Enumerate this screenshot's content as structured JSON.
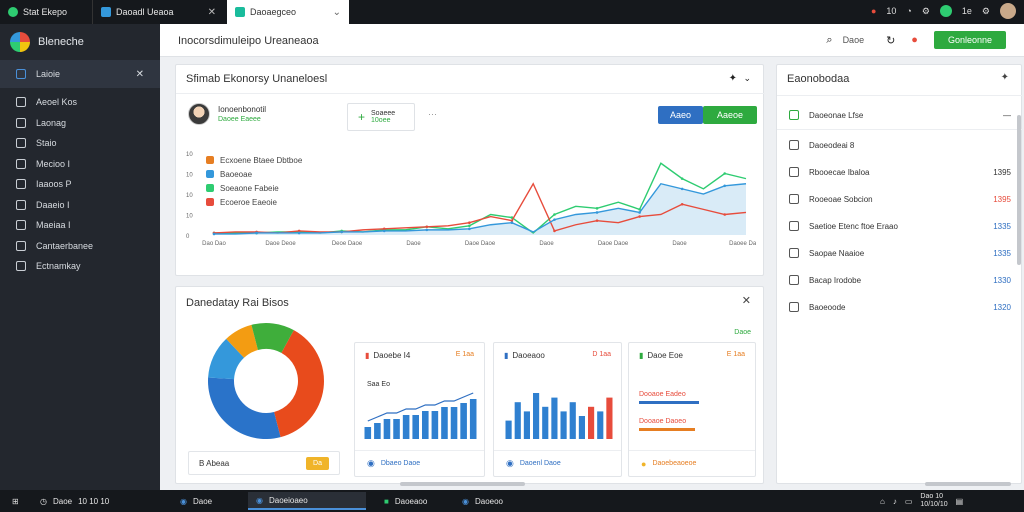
{
  "browser": {
    "tabs": [
      {
        "label": "Stat Ekepo",
        "color": "#2ecc71"
      },
      {
        "label": "Daoadl Ueaoa",
        "color": "#3498db"
      },
      {
        "label": "Daoaegceo",
        "color": "#1abc9c"
      }
    ],
    "top_right": {
      "notif_count": "10",
      "user": "1e"
    }
  },
  "sidebar": {
    "brand": "Bleneche",
    "items": [
      {
        "label": "Laioie",
        "icon": "dashboard-icon",
        "active": true
      },
      {
        "label": "Aeoel Kos",
        "icon": "wrench-icon"
      },
      {
        "label": "Laonag",
        "icon": "tools-icon"
      },
      {
        "label": "Staio",
        "icon": "gear-icon"
      },
      {
        "label": "Mecioo I",
        "icon": "chart-icon"
      },
      {
        "label": "Iaaoos P",
        "icon": "refresh-icon"
      },
      {
        "label": "Daaeio I",
        "icon": "clipboard-icon"
      },
      {
        "label": "Maeiaa I",
        "icon": "lock-icon"
      },
      {
        "label": "Cantaerbanee",
        "icon": "chat-icon"
      },
      {
        "label": "Ectnamkay",
        "icon": "user-icon"
      }
    ]
  },
  "header": {
    "title": "Inocorsdimuleipo Ureaneaoa",
    "search_label": "Daoe",
    "action_label": "Gonleonne"
  },
  "trend_card": {
    "title": "Sfimab Ekonorsy Unaneloesl",
    "user_name": "Ionoenbonotil",
    "user_sub": "Daoee Eaeee",
    "metric_label": "Soaeee",
    "metric_value": "10oee",
    "btn_blue": "Aaeo",
    "btn_green": "Aaeoe",
    "legend": [
      {
        "label": "Ecxoene Btaee Dbtboe",
        "color": "#e67e22"
      },
      {
        "label": "Baoeoae",
        "color": "#3498db"
      },
      {
        "label": "Soeaone Fabeie",
        "color": "#2ecc71"
      },
      {
        "label": "Ecoeroe Eaeoie",
        "color": "#e74c3c"
      }
    ],
    "y_ticks": [
      "10",
      "10",
      "10",
      "10",
      "0"
    ],
    "x_ticks": [
      "Dao Dao",
      "Daoe Deoe",
      "Deoe Daoe",
      "Daoe",
      "Daoe Daoe",
      "Daoe",
      "Daoe Daoe",
      "Daoe",
      "Daoee Daoe"
    ]
  },
  "chart_data": {
    "type": "line",
    "x": [
      0,
      1,
      2,
      3,
      4,
      5,
      6,
      7,
      8,
      9,
      10,
      11,
      12,
      13,
      14,
      15,
      16,
      17,
      18,
      19,
      20,
      21,
      22,
      23,
      24,
      25
    ],
    "series": [
      {
        "color": "#2ecc71",
        "values": [
          2,
          2,
          2,
          3,
          3,
          2,
          4,
          3,
          5,
          5,
          8,
          6,
          9,
          20,
          17,
          2,
          20,
          28,
          26,
          32,
          25,
          70,
          55,
          45,
          60,
          55
        ]
      },
      {
        "color": "#e74c3c",
        "values": [
          2,
          3,
          3,
          2,
          4,
          3,
          3,
          5,
          6,
          7,
          8,
          9,
          12,
          18,
          14,
          50,
          4,
          10,
          14,
          12,
          18,
          20,
          30,
          25,
          20,
          22
        ]
      },
      {
        "color": "#3498db",
        "values": [
          1,
          1,
          2,
          2,
          2,
          2,
          3,
          3,
          4,
          4,
          5,
          5,
          6,
          10,
          12,
          3,
          15,
          20,
          22,
          26,
          22,
          50,
          45,
          40,
          48,
          50
        ]
      }
    ],
    "ylim": [
      0,
      80
    ]
  },
  "distribution_card": {
    "title": "Danedatay Rai Bisos",
    "footer_label": "B Abeaa",
    "footer_button": "Da",
    "link": "Daoe",
    "donut": [
      {
        "value": 38,
        "color": "#e84b1c"
      },
      {
        "value": 30,
        "color": "#2a73c9"
      },
      {
        "value": 12,
        "color": "#3498db"
      },
      {
        "value": 8,
        "color": "#f39c12"
      },
      {
        "value": 12,
        "color": "#3fae3b"
      }
    ],
    "mini_cards": [
      {
        "title": "Daoebe I4",
        "value": "E 1aa",
        "label": "Saa Eo",
        "footer": "Dbaeo Daoe",
        "bars": [
          3,
          4,
          5,
          5,
          6,
          6,
          7,
          7,
          8,
          8,
          9,
          10
        ]
      },
      {
        "title": "Daoeaoo",
        "value": "D 1aa",
        "label": "",
        "footer": "Daoenl Daoe",
        "bars": [
          4,
          8,
          6,
          10,
          7,
          9,
          6,
          8,
          5,
          7,
          6,
          9
        ]
      },
      {
        "title": "Daoe Eoe",
        "value": "E 1aa",
        "label": "",
        "footer": "Daoebeaoeoe",
        "rows": [
          "Dooaoe Eadeo",
          "Dooaoe Daoeo"
        ]
      }
    ]
  },
  "right_panel": {
    "title": "Eaonobodaa",
    "top_row": "Daoeonae Lfse",
    "rows": [
      {
        "label": "Daoeodeai 8",
        "num": "",
        "color": "#333"
      },
      {
        "label": "Rbooecae Ibaloa",
        "num": "1395",
        "color": "#333"
      },
      {
        "label": "Rooeoae Sobcion",
        "num": "1395",
        "color": "#e74c3c"
      },
      {
        "label": "Saetioe Etenc ftoe Eraao",
        "num": "1335",
        "color": "#2f6fc2"
      },
      {
        "label": "Saopae Naaioe",
        "num": "1335",
        "color": "#2f6fc2"
      },
      {
        "label": "Bacap Irodobe",
        "num": "1330",
        "color": "#2f6fc2"
      },
      {
        "label": "Baoeoode",
        "num": "1320",
        "color": "#2f6fc2"
      }
    ]
  },
  "taskbar": {
    "left_label": "Daoe",
    "left_time": "10 10 10",
    "items": [
      "Daoe",
      "Daoeioaeo",
      "Daoeaoo",
      "Daoeoo"
    ],
    "clock": "Dao 10",
    "date": "10/10/10"
  }
}
